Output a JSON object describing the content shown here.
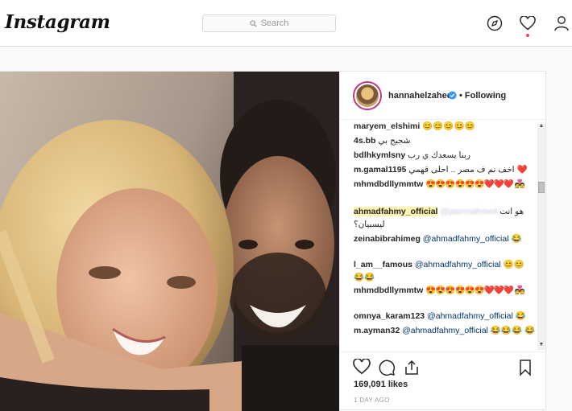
{
  "header": {
    "logo": "Instagram",
    "search_placeholder": "Search",
    "icons": [
      "explore-compass-icon",
      "activity-heart-icon",
      "profile-icon"
    ]
  },
  "post": {
    "username": "hannahelzahed",
    "follow_status": "• Following",
    "likes": "169,091 likes",
    "time_ago": "1 DAY AGO",
    "comments": [
      {
        "user": "maryem_elshimi",
        "text": "",
        "emoji": "😊😊😊😊😊"
      },
      {
        "user": "4s.bb",
        "text": "شجيج بي",
        "emoji": ""
      },
      {
        "user": "bdlhkymlsny",
        "text": "ربنا يسعدك ي رب",
        "emoji": ""
      },
      {
        "user": "m.gamal1195",
        "text": "اخف نم ف مصر .. احلى قهمي",
        "emoji": "❤️"
      },
      {
        "user": "mhmdbdllymmtw",
        "text": "",
        "emoji": "😍😍😍😍😍😍❤️❤️❤️ 💑"
      },
      {
        "user": "ahmadfahmy_official",
        "mention": "@jasmnahmed",
        "text": "هو انت ليسبيان؟"
      },
      {
        "user": "zeinabibrahimeg",
        "mention": "@ahmadfahmy_official",
        "emoji": "😂"
      },
      {
        "user": "l_am__famous",
        "mention": "@ahmadfahmy_official",
        "emoji": "😊😊 😂😂"
      },
      {
        "user": "mhmdbdllymmtw",
        "text": "",
        "emoji": "😍😍😍😍😍😍❤️❤️❤️ 💑"
      },
      {
        "user": "omnya_karam123",
        "mention": "@ahmadfahmy_official",
        "emoji": "😂"
      },
      {
        "user": "m.ayman32",
        "mention": "@ahmadfahmy_official",
        "emoji": "😂😂😂 😂"
      }
    ]
  }
}
